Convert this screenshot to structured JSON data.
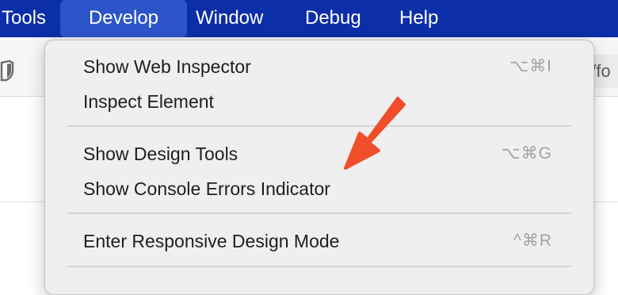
{
  "menubar": {
    "items": [
      {
        "label": "Tools"
      },
      {
        "label": "Develop"
      },
      {
        "label": "Window"
      },
      {
        "label": "Debug"
      },
      {
        "label": "Help"
      }
    ],
    "active_index": 1
  },
  "background": {
    "address_fragment": "n/fo"
  },
  "develop_menu": {
    "items": [
      {
        "label": "Show Web Inspector",
        "shortcut": "⌥⌘I"
      },
      {
        "label": "Inspect Element",
        "shortcut": ""
      },
      {
        "label": "Show Design Tools",
        "shortcut": "⌥⌘G"
      },
      {
        "label": "Show Console Errors Indicator",
        "shortcut": ""
      },
      {
        "label": "Enter Responsive Design Mode",
        "shortcut": "^⌘R"
      }
    ]
  },
  "annotation": {
    "arrow_color": "#f04e2a",
    "target": "Show Console Errors Indicator"
  },
  "colors": {
    "menubar_bg": "#0c2fa8",
    "menubar_active": "#2b55c9",
    "menu_bg": "#efefef"
  }
}
